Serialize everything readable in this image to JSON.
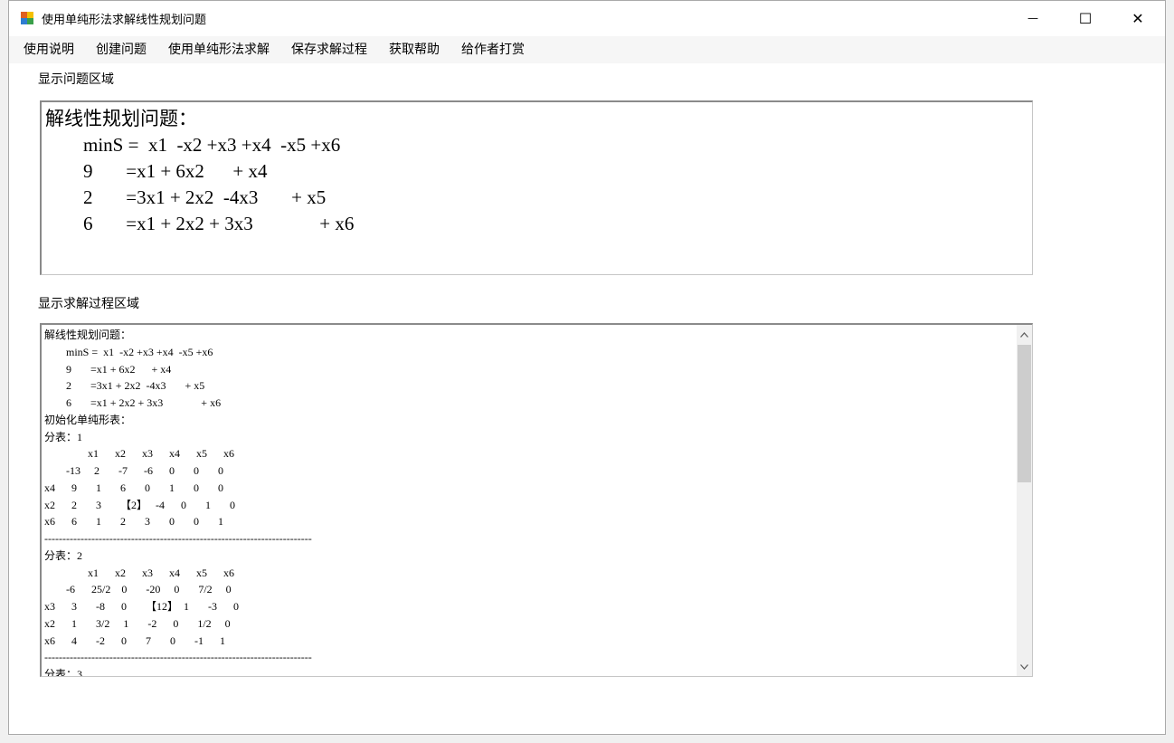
{
  "window": {
    "title": "使用单纯形法求解线性规划问题",
    "controls": {
      "minimize": "—",
      "maximize": "☐",
      "close": "✕"
    }
  },
  "menu": {
    "items": [
      "使用说明",
      "创建问题",
      "使用单纯形法求解",
      "保存求解过程",
      "获取帮助",
      "给作者打赏"
    ]
  },
  "problem_area": {
    "label": "显示问题区域",
    "text": "解线性规划问题：\n        minS =  x1  -x2 +x3 +x4  -x5 +x6\n        9       =x1 + 6x2      + x4\n        2       =3x1 + 2x2  -4x3       + x5\n        6       =x1 + 2x2 + 3x3              + x6"
  },
  "solution_area": {
    "label": "显示求解过程区域",
    "text": "解线性规划问题：\n        minS =  x1  -x2 +x3 +x4  -x5 +x6\n        9       =x1 + 6x2      + x4\n        2       =3x1 + 2x2  -4x3       + x5\n        6       =x1 + 2x2 + 3x3              + x6\n初始化单纯形表：\n分表：1\n                x1      x2      x3      x4      x5      x6\n        -13     2       -7      -6      0       0       0\nx4      9       1       6       0       1       0       0\nx2      2       3       【2】   -4      0       1       0\nx6      6       1       2       3       0       0       1\n--------------------------------------------------------------------------\n分表：2\n                x1      x2      x3      x4      x5      x6\n        -6      25/2    0       -20     0       7/2     0\nx3      3       -8      0       【12】  1       -3      0\nx2      1       3/2     1       -2      0       1/2     0\nx6      4       -2      0       7       0       -1      1\n--------------------------------------------------------------------------\n分表：3"
  }
}
